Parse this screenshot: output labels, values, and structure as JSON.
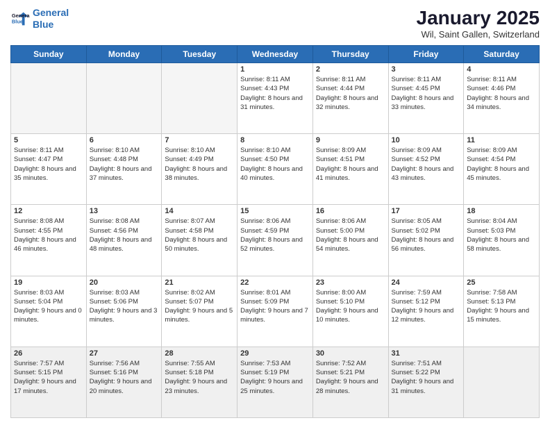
{
  "logo": {
    "line1": "General",
    "line2": "Blue"
  },
  "title": "January 2025",
  "location": "Wil, Saint Gallen, Switzerland",
  "days_of_week": [
    "Sunday",
    "Monday",
    "Tuesday",
    "Wednesday",
    "Thursday",
    "Friday",
    "Saturday"
  ],
  "weeks": [
    [
      {
        "day": "",
        "info": ""
      },
      {
        "day": "",
        "info": ""
      },
      {
        "day": "",
        "info": ""
      },
      {
        "day": "1",
        "info": "Sunrise: 8:11 AM\nSunset: 4:43 PM\nDaylight: 8 hours and 31 minutes."
      },
      {
        "day": "2",
        "info": "Sunrise: 8:11 AM\nSunset: 4:44 PM\nDaylight: 8 hours and 32 minutes."
      },
      {
        "day": "3",
        "info": "Sunrise: 8:11 AM\nSunset: 4:45 PM\nDaylight: 8 hours and 33 minutes."
      },
      {
        "day": "4",
        "info": "Sunrise: 8:11 AM\nSunset: 4:46 PM\nDaylight: 8 hours and 34 minutes."
      }
    ],
    [
      {
        "day": "5",
        "info": "Sunrise: 8:11 AM\nSunset: 4:47 PM\nDaylight: 8 hours and 35 minutes."
      },
      {
        "day": "6",
        "info": "Sunrise: 8:10 AM\nSunset: 4:48 PM\nDaylight: 8 hours and 37 minutes."
      },
      {
        "day": "7",
        "info": "Sunrise: 8:10 AM\nSunset: 4:49 PM\nDaylight: 8 hours and 38 minutes."
      },
      {
        "day": "8",
        "info": "Sunrise: 8:10 AM\nSunset: 4:50 PM\nDaylight: 8 hours and 40 minutes."
      },
      {
        "day": "9",
        "info": "Sunrise: 8:09 AM\nSunset: 4:51 PM\nDaylight: 8 hours and 41 minutes."
      },
      {
        "day": "10",
        "info": "Sunrise: 8:09 AM\nSunset: 4:52 PM\nDaylight: 8 hours and 43 minutes."
      },
      {
        "day": "11",
        "info": "Sunrise: 8:09 AM\nSunset: 4:54 PM\nDaylight: 8 hours and 45 minutes."
      }
    ],
    [
      {
        "day": "12",
        "info": "Sunrise: 8:08 AM\nSunset: 4:55 PM\nDaylight: 8 hours and 46 minutes."
      },
      {
        "day": "13",
        "info": "Sunrise: 8:08 AM\nSunset: 4:56 PM\nDaylight: 8 hours and 48 minutes."
      },
      {
        "day": "14",
        "info": "Sunrise: 8:07 AM\nSunset: 4:58 PM\nDaylight: 8 hours and 50 minutes."
      },
      {
        "day": "15",
        "info": "Sunrise: 8:06 AM\nSunset: 4:59 PM\nDaylight: 8 hours and 52 minutes."
      },
      {
        "day": "16",
        "info": "Sunrise: 8:06 AM\nSunset: 5:00 PM\nDaylight: 8 hours and 54 minutes."
      },
      {
        "day": "17",
        "info": "Sunrise: 8:05 AM\nSunset: 5:02 PM\nDaylight: 8 hours and 56 minutes."
      },
      {
        "day": "18",
        "info": "Sunrise: 8:04 AM\nSunset: 5:03 PM\nDaylight: 8 hours and 58 minutes."
      }
    ],
    [
      {
        "day": "19",
        "info": "Sunrise: 8:03 AM\nSunset: 5:04 PM\nDaylight: 9 hours and 0 minutes."
      },
      {
        "day": "20",
        "info": "Sunrise: 8:03 AM\nSunset: 5:06 PM\nDaylight: 9 hours and 3 minutes."
      },
      {
        "day": "21",
        "info": "Sunrise: 8:02 AM\nSunset: 5:07 PM\nDaylight: 9 hours and 5 minutes."
      },
      {
        "day": "22",
        "info": "Sunrise: 8:01 AM\nSunset: 5:09 PM\nDaylight: 9 hours and 7 minutes."
      },
      {
        "day": "23",
        "info": "Sunrise: 8:00 AM\nSunset: 5:10 PM\nDaylight: 9 hours and 10 minutes."
      },
      {
        "day": "24",
        "info": "Sunrise: 7:59 AM\nSunset: 5:12 PM\nDaylight: 9 hours and 12 minutes."
      },
      {
        "day": "25",
        "info": "Sunrise: 7:58 AM\nSunset: 5:13 PM\nDaylight: 9 hours and 15 minutes."
      }
    ],
    [
      {
        "day": "26",
        "info": "Sunrise: 7:57 AM\nSunset: 5:15 PM\nDaylight: 9 hours and 17 minutes."
      },
      {
        "day": "27",
        "info": "Sunrise: 7:56 AM\nSunset: 5:16 PM\nDaylight: 9 hours and 20 minutes."
      },
      {
        "day": "28",
        "info": "Sunrise: 7:55 AM\nSunset: 5:18 PM\nDaylight: 9 hours and 23 minutes."
      },
      {
        "day": "29",
        "info": "Sunrise: 7:53 AM\nSunset: 5:19 PM\nDaylight: 9 hours and 25 minutes."
      },
      {
        "day": "30",
        "info": "Sunrise: 7:52 AM\nSunset: 5:21 PM\nDaylight: 9 hours and 28 minutes."
      },
      {
        "day": "31",
        "info": "Sunrise: 7:51 AM\nSunset: 5:22 PM\nDaylight: 9 hours and 31 minutes."
      },
      {
        "day": "",
        "info": ""
      }
    ]
  ]
}
